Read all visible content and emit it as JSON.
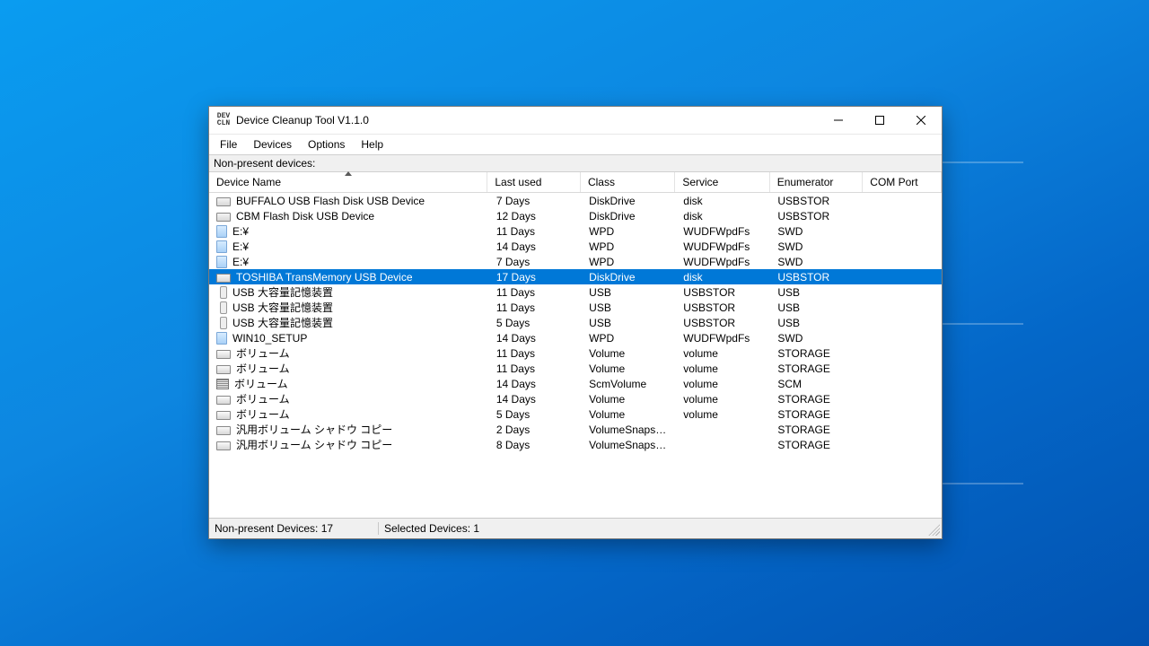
{
  "window": {
    "title": "Device Cleanup Tool V1.1.0",
    "icon_text": "DEV\nCLN"
  },
  "menu": {
    "file": "File",
    "devices": "Devices",
    "options": "Options",
    "help": "Help"
  },
  "label": "Non-present devices:",
  "columns": {
    "device_name": "Device Name",
    "last_used": "Last used",
    "class": "Class",
    "service": "Service",
    "enumerator": "Enumerator",
    "com_port": "COM Port"
  },
  "rows": [
    {
      "icon": "disk",
      "name": "BUFFALO USB Flash Disk USB Device",
      "last": "7 Days",
      "class": "DiskDrive",
      "service": "disk",
      "enum": "USBSTOR",
      "com": "",
      "selected": false
    },
    {
      "icon": "disk",
      "name": "CBM Flash Disk USB Device",
      "last": "12 Days",
      "class": "DiskDrive",
      "service": "disk",
      "enum": "USBSTOR",
      "com": "",
      "selected": false
    },
    {
      "icon": "wpd",
      "name": "E:¥",
      "last": "11 Days",
      "class": "WPD",
      "service": "WUDFWpdFs",
      "enum": "SWD",
      "com": "",
      "selected": false
    },
    {
      "icon": "wpd",
      "name": "E:¥",
      "last": "14 Days",
      "class": "WPD",
      "service": "WUDFWpdFs",
      "enum": "SWD",
      "com": "",
      "selected": false
    },
    {
      "icon": "wpd",
      "name": "E:¥",
      "last": "7 Days",
      "class": "WPD",
      "service": "WUDFWpdFs",
      "enum": "SWD",
      "com": "",
      "selected": false
    },
    {
      "icon": "disk",
      "name": "TOSHIBA TransMemory USB Device",
      "last": "17 Days",
      "class": "DiskDrive",
      "service": "disk",
      "enum": "USBSTOR",
      "com": "",
      "selected": true
    },
    {
      "icon": "usb",
      "name": "USB 大容量記憶装置",
      "last": "11 Days",
      "class": "USB",
      "service": "USBSTOR",
      "enum": "USB",
      "com": "",
      "selected": false
    },
    {
      "icon": "usb",
      "name": "USB 大容量記憶装置",
      "last": "11 Days",
      "class": "USB",
      "service": "USBSTOR",
      "enum": "USB",
      "com": "",
      "selected": false
    },
    {
      "icon": "usb",
      "name": "USB 大容量記憶装置",
      "last": "5 Days",
      "class": "USB",
      "service": "USBSTOR",
      "enum": "USB",
      "com": "",
      "selected": false
    },
    {
      "icon": "wpd",
      "name": "WIN10_SETUP",
      "last": "14 Days",
      "class": "WPD",
      "service": "WUDFWpdFs",
      "enum": "SWD",
      "com": "",
      "selected": false
    },
    {
      "icon": "vol",
      "name": "ボリューム",
      "last": "11 Days",
      "class": "Volume",
      "service": "volume",
      "enum": "STORAGE",
      "com": "",
      "selected": false
    },
    {
      "icon": "vol",
      "name": "ボリューム",
      "last": "11 Days",
      "class": "Volume",
      "service": "volume",
      "enum": "STORAGE",
      "com": "",
      "selected": false
    },
    {
      "icon": "scm",
      "name": "ボリューム",
      "last": "14 Days",
      "class": "ScmVolume",
      "service": "volume",
      "enum": "SCM",
      "com": "",
      "selected": false
    },
    {
      "icon": "vol",
      "name": "ボリューム",
      "last": "14 Days",
      "class": "Volume",
      "service": "volume",
      "enum": "STORAGE",
      "com": "",
      "selected": false
    },
    {
      "icon": "vol",
      "name": "ボリューム",
      "last": "5 Days",
      "class": "Volume",
      "service": "volume",
      "enum": "STORAGE",
      "com": "",
      "selected": false
    },
    {
      "icon": "vol",
      "name": "汎用ボリューム シャドウ コピー",
      "last": "2 Days",
      "class": "VolumeSnapshot",
      "service": "",
      "enum": "STORAGE",
      "com": "",
      "selected": false
    },
    {
      "icon": "vol",
      "name": "汎用ボリューム シャドウ コピー",
      "last": "8 Days",
      "class": "VolumeSnapshot",
      "service": "",
      "enum": "STORAGE",
      "com": "",
      "selected": false
    }
  ],
  "status": {
    "non_present": "Non-present Devices: 17",
    "selected": "Selected Devices: 1"
  }
}
